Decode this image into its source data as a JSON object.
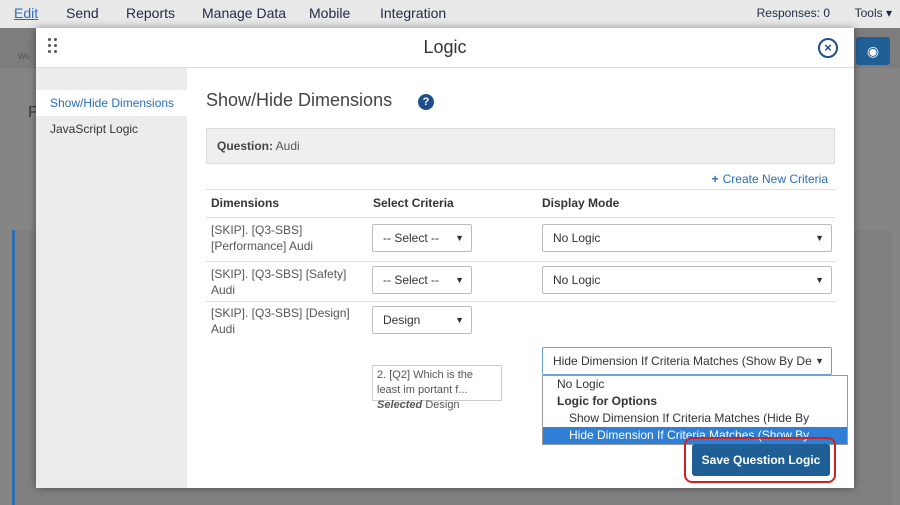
{
  "app": {
    "menu": [
      "Edit",
      "Send",
      "Reports",
      "Manage Data",
      "Mobile",
      "Integration"
    ],
    "responses": "Responses: 0",
    "tools": "Tools ▾",
    "bg_letter": "P",
    "bg_small": "Wo"
  },
  "modal": {
    "title": "Logic",
    "close_icon": "×"
  },
  "sidebar": {
    "items": [
      {
        "label": "Show/Hide Dimensions",
        "active": true
      },
      {
        "label": "JavaScript Logic",
        "active": false
      }
    ]
  },
  "section": {
    "title": "Show/Hide Dimensions",
    "help": "?"
  },
  "question": {
    "label": "Question:",
    "value": "Audi"
  },
  "create_criteria": "Create New Criteria",
  "table": {
    "headers": [
      "Dimensions",
      "Select Criteria",
      "Display Mode"
    ],
    "rows": [
      {
        "dimension": "[SKIP]. [Q3-SBS] [Performance] Audi",
        "criteria": "-- Select --",
        "mode": "No Logic"
      },
      {
        "dimension": "[SKIP]. [Q3-SBS] [Safety] Audi",
        "criteria": "-- Select --",
        "mode": "No Logic"
      },
      {
        "dimension": "[SKIP]. [Q3-SBS] [Design] Audi",
        "criteria": "Design",
        "mode": "Hide Dimension If Criteria Matches (Show By De",
        "note_prefix": "2. [Q2] Which is the least im portant f...",
        "note_selected": "Selected",
        "note_suffix": "Design"
      }
    ]
  },
  "dropdown": {
    "options": [
      {
        "label": "No Logic",
        "type": "option"
      },
      {
        "label": "Logic for Options",
        "type": "group"
      },
      {
        "label": "Show Dimension If Criteria Matches (Hide By Default)",
        "type": "option-indent"
      },
      {
        "label": "Hide Dimension If Criteria Matches (Show By Default)",
        "type": "selected"
      }
    ]
  },
  "save_button": "Save Question Logic",
  "colors": {
    "accent": "#2a6ebb",
    "primary_button": "#1f5f96",
    "highlight": "#d02020",
    "selected_option": "#2f7fd6"
  }
}
